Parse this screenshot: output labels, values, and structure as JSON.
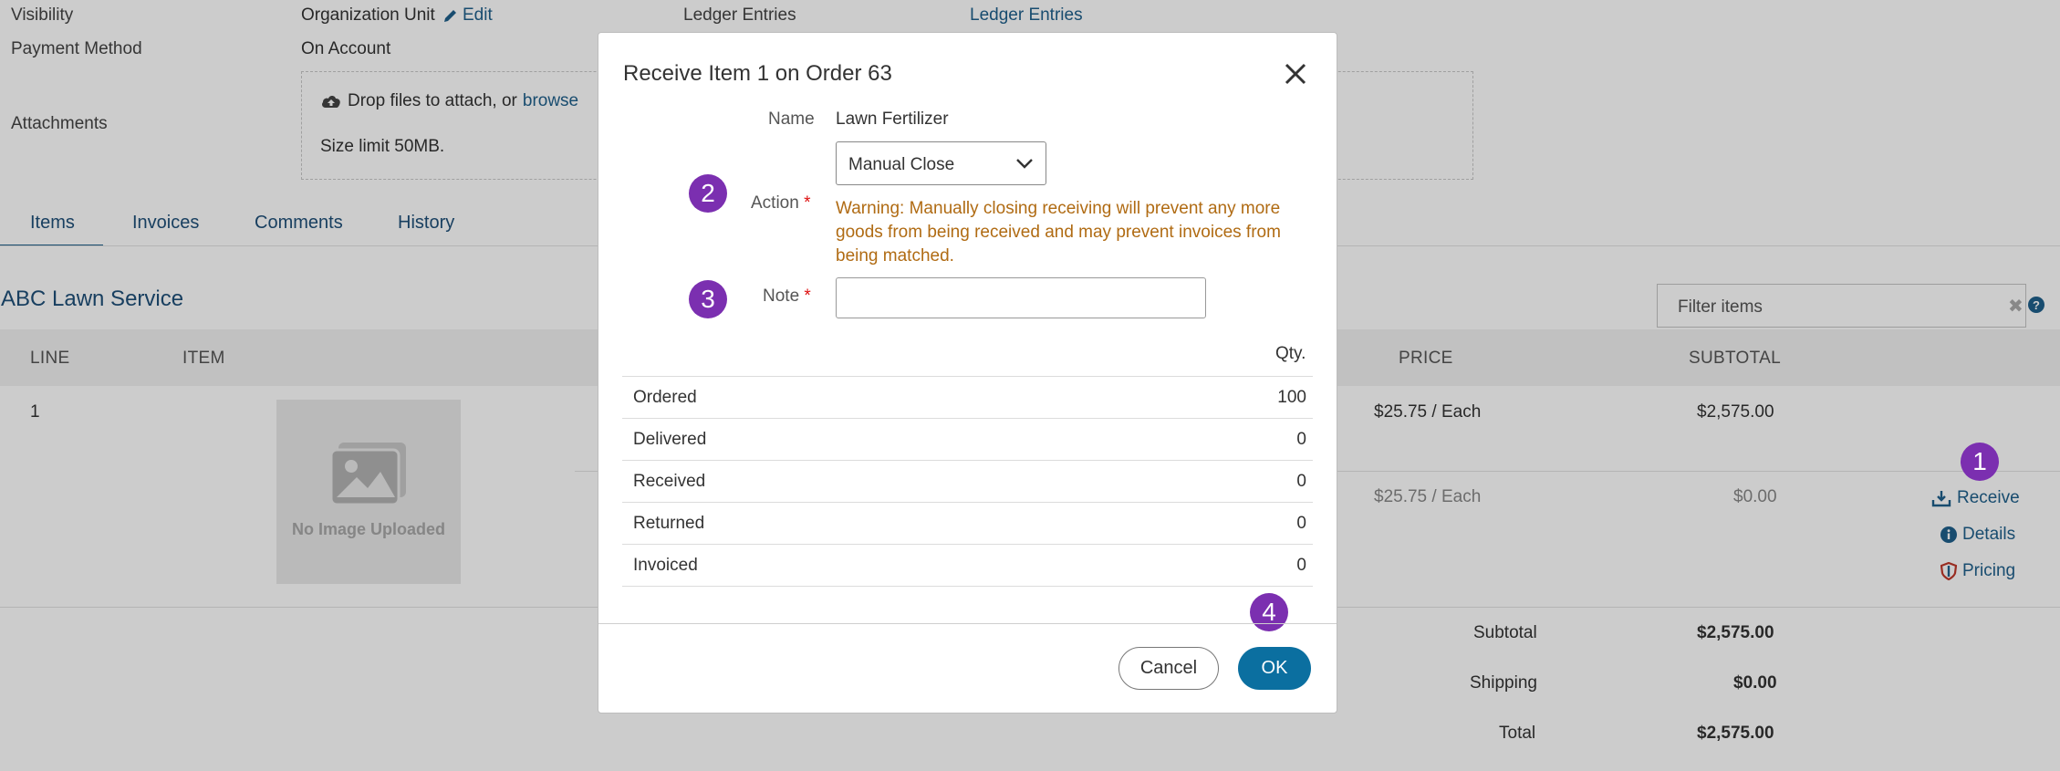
{
  "info": {
    "visibility_label": "Visibility",
    "visibility_value": "Organization Unit",
    "edit_label": "Edit",
    "ledger_label": "Ledger Entries",
    "ledger_link": "Ledger Entries",
    "payment_label": "Payment Method",
    "payment_value": "On Account",
    "attachments_label": "Attachments",
    "drop_text": "Drop files to attach, or",
    "browse_link": "browse",
    "size_limit": "Size limit 50MB."
  },
  "tabs": [
    "Items",
    "Invoices",
    "Comments",
    "History"
  ],
  "vendor": "ABC Lawn Service",
  "filter_placeholder": "Filter items",
  "table": {
    "headers": {
      "line": "LINE",
      "item": "ITEM",
      "price": "PRICE",
      "subtotal": "SUBTOTAL"
    },
    "row": {
      "line": "1",
      "price": "$25.75 / Each",
      "subtotal": "$2,575.00"
    },
    "subrow": {
      "price": "$25.75 / Each",
      "subtotal": "$0.00"
    },
    "no_image": "No Image Uploaded",
    "actions": {
      "receive": "Receive",
      "details": "Details",
      "pricing": "Pricing"
    }
  },
  "totals": {
    "subtotal_label": "Subtotal",
    "subtotal": "$2,575.00",
    "shipping_label": "Shipping",
    "shipping": "$0.00",
    "total_label": "Total",
    "total": "$2,575.00"
  },
  "markers": {
    "m1": "1",
    "m2": "2",
    "m3": "3",
    "m4": "4"
  },
  "modal": {
    "title": "Receive Item 1 on Order 63",
    "name_label": "Name",
    "name_value": "Lawn Fertilizer",
    "action_label": "Action",
    "action_value": "Manual Close",
    "required_mark": "*",
    "warning": "Warning: Manually closing receiving will prevent any more goods from being received and may prevent invoices from being matched.",
    "note_label": "Note",
    "note_value": "",
    "qty_header": "Qty.",
    "rows": [
      {
        "label": "Ordered",
        "qty": "100"
      },
      {
        "label": "Delivered",
        "qty": "0"
      },
      {
        "label": "Received",
        "qty": "0"
      },
      {
        "label": "Returned",
        "qty": "0"
      },
      {
        "label": "Invoiced",
        "qty": "0"
      }
    ],
    "cancel_label": "Cancel",
    "ok_label": "OK"
  },
  "colors": {
    "accent": "#1f5f8b",
    "marker": "#7b2fb0",
    "warning": "#b06b13",
    "ok": "#0b6fa0"
  }
}
